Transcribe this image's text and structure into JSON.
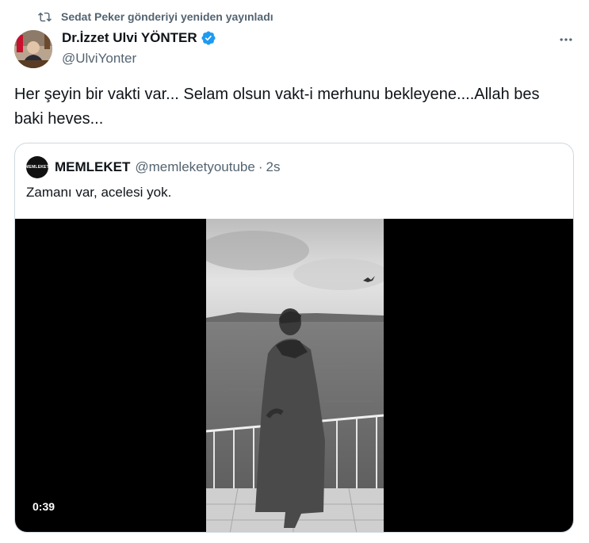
{
  "retweet": {
    "text": "Sedat Peker gönderiyi yeniden yayınladı",
    "icon": "retweet-icon"
  },
  "author": {
    "name": "Dr.İzzet Ulvi YÖNTER",
    "handle": "@UlviYonter",
    "verified_color": "#1d9bf0"
  },
  "more_icon": "more-horizontal-icon",
  "tweet_text": "Her şeyin bir vakti var... Selam olsun vakt-i merhunu bekleyene....Allah bes baki heves...",
  "quote": {
    "avatar_text": "MEMLEKET",
    "name": "MEMLEKET",
    "handle": "@memleketyoutube",
    "separator": "·",
    "time": "2s",
    "text": "Zamanı var, acelesi yok.",
    "video": {
      "duration": "0:39"
    }
  }
}
